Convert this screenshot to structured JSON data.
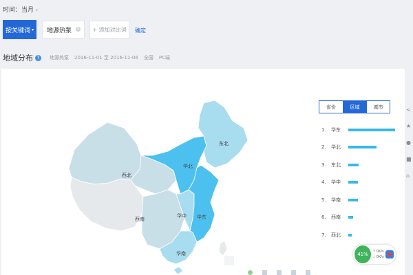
{
  "header": {
    "time_label": "时间：当月",
    "time_chevron": "›"
  },
  "keywords": {
    "active_button": "按关键词",
    "tag": "地源热泵",
    "add_compare": "+ 添加对比词",
    "confirm": "确定"
  },
  "section": {
    "title": "地域分布",
    "keyword": "地源热泵",
    "date_range": "2016-11-01 至 2016-11-06",
    "scope": "全国",
    "device": "PC端"
  },
  "tabs": [
    {
      "label": "省份",
      "active": false
    },
    {
      "label": "区域",
      "active": true
    },
    {
      "label": "城市",
      "active": false
    }
  ],
  "ranking": [
    {
      "rank": "1.",
      "name": "华东",
      "value": 1.0
    },
    {
      "rank": "2.",
      "name": "华北",
      "value": 0.61
    },
    {
      "rank": "3.",
      "name": "东北",
      "value": 0.22
    },
    {
      "rank": "4.",
      "name": "华中",
      "value": 0.21
    },
    {
      "rank": "5.",
      "name": "华南",
      "value": 0.2
    },
    {
      "rank": "6.",
      "name": "西南",
      "value": 0.1
    },
    {
      "rank": "7.",
      "name": "西北",
      "value": 0.08
    }
  ],
  "map_labels": {
    "dongbei": "东北",
    "huabei": "华北",
    "xibei": "西北",
    "huadong": "华东",
    "huazhong": "华中",
    "xinan": "西南",
    "huanan": "华南"
  },
  "speed_widget": {
    "percent": "41%",
    "up": "0K/s",
    "down": "0K/s"
  },
  "colors": {
    "accent": "#2468d8",
    "bar": "#35b8ea",
    "region_high": "#4cc1ef",
    "region_mid": "#a8dcef",
    "region_low": "#c9dfe8",
    "region_none": "#e6e9ec"
  }
}
